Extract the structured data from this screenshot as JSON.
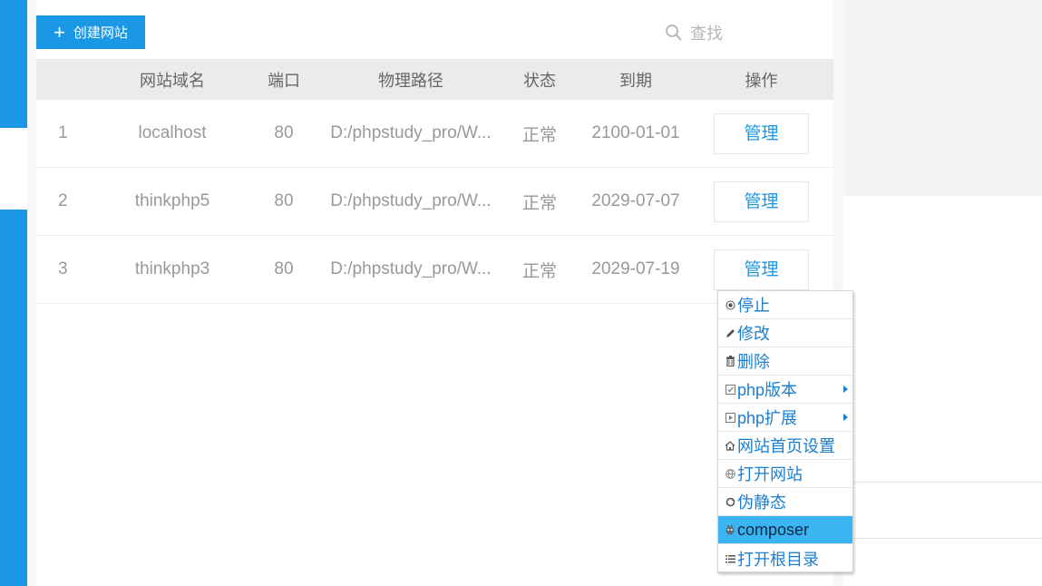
{
  "toolbar": {
    "create_label": "创建网站",
    "search_label": "查找"
  },
  "table": {
    "headers": [
      "",
      "网站域名",
      "端口",
      "物理路径",
      "状态",
      "到期",
      "操作"
    ],
    "rows": [
      {
        "index": "1",
        "domain": "localhost",
        "port": "80",
        "path": "D:/phpstudy_pro/W...",
        "status": "正常",
        "expiry": "2100-01-01",
        "action": "管理"
      },
      {
        "index": "2",
        "domain": "thinkphp5",
        "port": "80",
        "path": "D:/phpstudy_pro/W...",
        "status": "正常",
        "expiry": "2029-07-07",
        "action": "管理"
      },
      {
        "index": "3",
        "domain": "thinkphp3",
        "port": "80",
        "path": "D:/phpstudy_pro/W...",
        "status": "正常",
        "expiry": "2029-07-19",
        "action": "管理"
      }
    ]
  },
  "context_menu": {
    "items": [
      {
        "label": "停止",
        "icon": "stop-icon"
      },
      {
        "label": "修改",
        "icon": "pencil-icon"
      },
      {
        "label": "删除",
        "icon": "trash-icon"
      },
      {
        "label": "php版本",
        "icon": "php-version-icon",
        "submenu": true
      },
      {
        "label": "php扩展",
        "icon": "php-extension-icon",
        "submenu": true
      },
      {
        "label": "网站首页设置",
        "icon": "home-icon"
      },
      {
        "label": "打开网站",
        "icon": "globe-icon"
      },
      {
        "label": "伪静态",
        "icon": "rewrite-icon"
      },
      {
        "label": "composer",
        "icon": "composer-icon",
        "highlighted": true
      },
      {
        "label": "打开根目录",
        "icon": "list-icon"
      }
    ]
  },
  "colors": {
    "accent": "#1a98e6",
    "menu_text": "#1a7fd0",
    "menu_highlight": "#3bb4f2",
    "header_bg": "#ebebeb"
  }
}
